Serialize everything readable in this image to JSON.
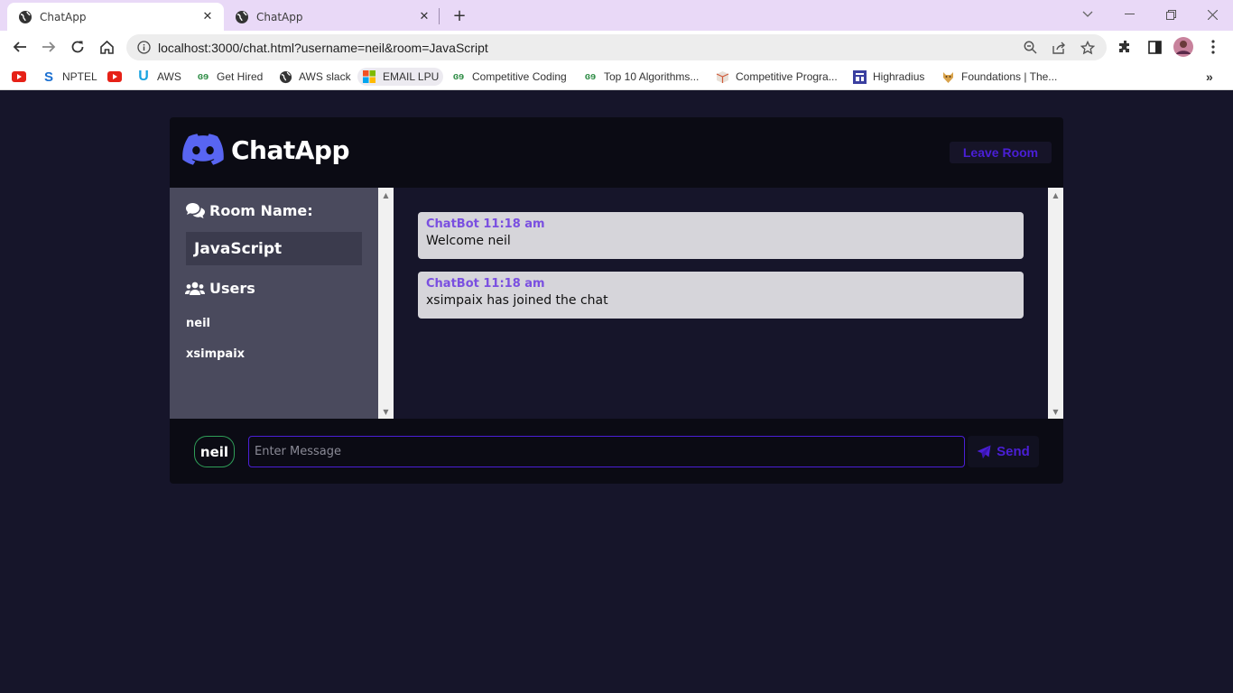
{
  "browser": {
    "tabs": [
      {
        "title": "ChatApp",
        "active": true
      },
      {
        "title": "ChatApp",
        "active": false
      }
    ],
    "url": "localhost:3000/chat.html?username=neil&room=JavaScript",
    "bookmarks": [
      {
        "label": "",
        "icon": "youtube-icon"
      },
      {
        "label": "NPTEL",
        "icon": "swayam-icon"
      },
      {
        "label": "",
        "icon": "youtube-icon"
      },
      {
        "label": "AWS",
        "icon": "udemy-icon"
      },
      {
        "label": "Get Hired",
        "icon": "gfg-icon"
      },
      {
        "label": "AWS slack",
        "icon": "globe-icon"
      },
      {
        "label": "EMAIL LPU",
        "icon": "microsoft-icon"
      },
      {
        "label": "Competitive Coding",
        "icon": "gfg-icon"
      },
      {
        "label": "Top 10 Algorithms...",
        "icon": "gfg-icon"
      },
      {
        "label": "Competitive Progra...",
        "icon": "box-icon"
      },
      {
        "label": "Highradius",
        "icon": "grid-icon"
      },
      {
        "label": "Foundations | The...",
        "icon": "odin-icon"
      }
    ]
  },
  "app": {
    "name": "ChatApp",
    "leave_label": "Leave Room",
    "room_heading": "Room Name:",
    "room_name": "JavaScript",
    "users_heading": "Users",
    "users": [
      "neil",
      "xsimpaix"
    ],
    "messages": [
      {
        "user": "ChatBot",
        "time": "11:18 am",
        "text": "Welcome neil"
      },
      {
        "user": "ChatBot",
        "time": "11:18 am",
        "text": "xsimpaix has joined the chat"
      }
    ],
    "current_user": "neil",
    "input_placeholder": "Enter Message",
    "send_label": "Send",
    "colors": {
      "accent": "#4a1fd6",
      "meta": "#7a4fe0",
      "page_bg": "#16152a",
      "panel_bg": "#0b0b14",
      "sidebar_bg": "#4a4a5d"
    }
  }
}
